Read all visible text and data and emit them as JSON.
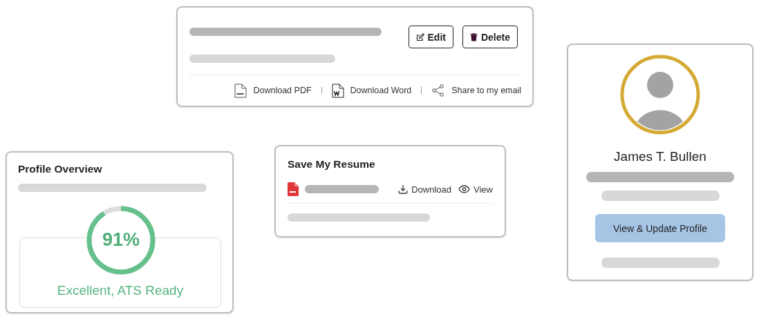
{
  "resume_card": {
    "buttons": [
      {
        "kind": "edit",
        "label": "Edit"
      },
      {
        "kind": "delete",
        "label": "Delete"
      }
    ],
    "links": [
      {
        "kind": "pdf",
        "label": "Download PDF"
      },
      {
        "kind": "word",
        "label": "Download Word"
      },
      {
        "kind": "share",
        "label": "Share to my email"
      }
    ]
  },
  "profile_overview": {
    "title": "Profile Overview",
    "score": {
      "level": 0.91,
      "label": "91%"
    },
    "status": "Excellent, ATS Ready"
  },
  "save_resume": {
    "title": "Save My Resume",
    "actions": [
      {
        "kind": "download",
        "label": "Download"
      },
      {
        "kind": "view",
        "label": "View"
      }
    ]
  },
  "profile_card": {
    "name": "James T. Bullen",
    "button": "View & Update Profile"
  }
}
